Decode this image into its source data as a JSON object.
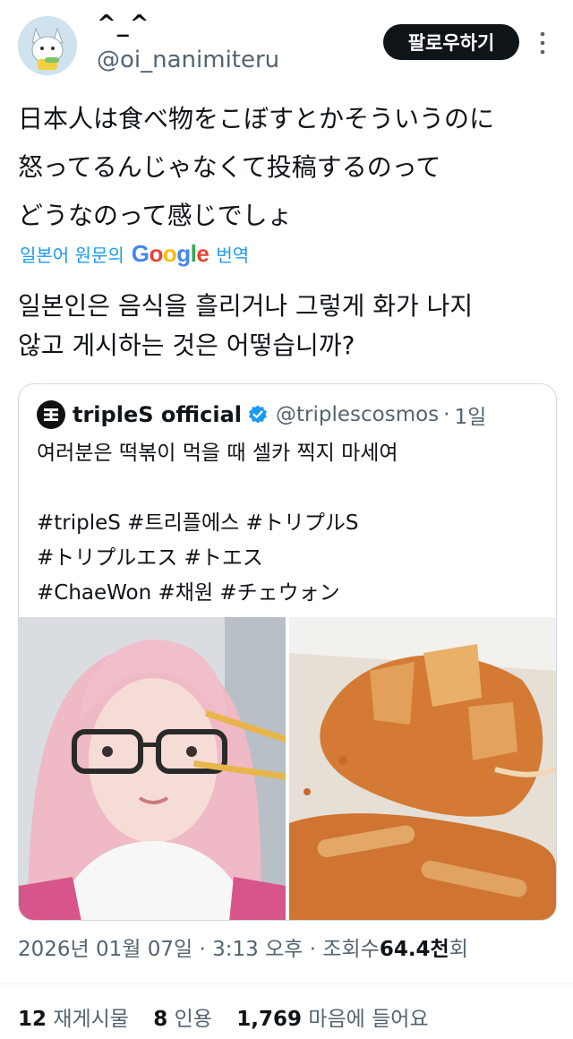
{
  "author": {
    "display_name": "^_^",
    "handle": "@oi_nanimiteru",
    "avatar_icon": "cat-character-avatar"
  },
  "follow_label": "팔로우하기",
  "more_icon": "more-vertical-icon",
  "post": {
    "original_lines": [
      "日本人は食べ物をこぼすとかそういうのに",
      "怒ってるんじゃなくて投稿するのって",
      "どうなのって感じでしょ"
    ],
    "translate_prefix": "일본어 원문의",
    "translate_brand": "Google",
    "translate_suffix": "번역",
    "translated_lines": [
      "일본인은 음식을 흘리거나 그렇게 화가 나지",
      "않고 게시하는 것은 어떻습니까?"
    ]
  },
  "quote": {
    "name": "tripleS official",
    "handle": "@triplescosmos",
    "separator": "·",
    "time": "1일",
    "verified_icon": "verified-badge-icon",
    "logo_icon": "triples-logo-icon",
    "text_lines": [
      "여러분은 떡볶이 먹을 때 셀카 찍지 마세여",
      "",
      "#tripleS #트리플에스 #トリプルS",
      "#トリプルエス #トエス",
      "#ChaeWon #채원 #チェウォン"
    ],
    "media": [
      "selfie-photo",
      "spilled-tteokbokki-photo"
    ]
  },
  "meta": {
    "date": "2026년 01월 07일",
    "sep1": "·",
    "time": "3:13 오후",
    "sep2": "·",
    "views_label": "조회수",
    "views_value": "64.4천",
    "views_suffix": "회"
  },
  "stats": {
    "reposts_count": "12",
    "reposts_label": "재게시물",
    "quotes_count": "8",
    "quotes_label": "인용",
    "likes_count": "1,769",
    "likes_label": "마음에 들어요"
  },
  "colors": {
    "link": "#1d9bf0",
    "secondary_text": "#536471",
    "primary_text": "#0f1419",
    "verified": "#1d9bf0",
    "button_bg": "#0f1419"
  }
}
